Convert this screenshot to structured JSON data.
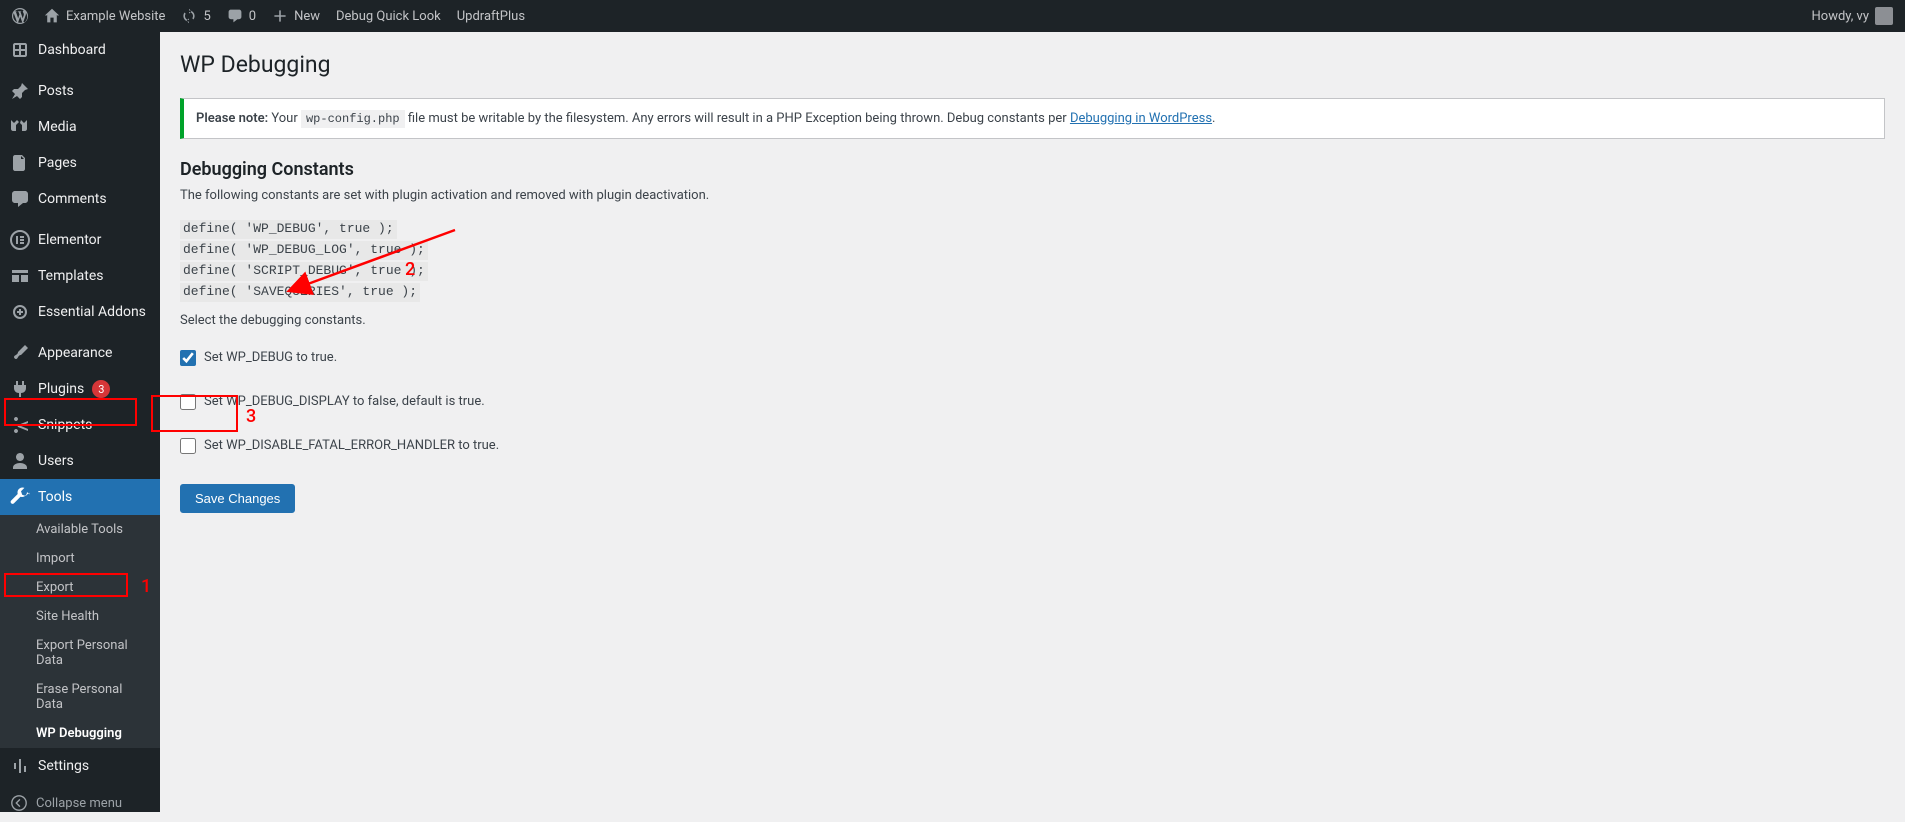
{
  "adminbar": {
    "site": "Example Website",
    "refresh_count": "5",
    "comments_count": "0",
    "new_label": "New",
    "debug_link": "Debug Quick Look",
    "updraft_link": "UpdraftPlus",
    "greeting": "Howdy, vy"
  },
  "sidebar": {
    "dashboard": "Dashboard",
    "posts": "Posts",
    "media": "Media",
    "pages": "Pages",
    "comments": "Comments",
    "elementor": "Elementor",
    "templates": "Templates",
    "essential_addons": "Essential Addons",
    "appearance": "Appearance",
    "plugins": "Plugins",
    "plugins_badge": "3",
    "snippets": "Snippets",
    "users": "Users",
    "tools": "Tools",
    "tools_sub": {
      "available": "Available Tools",
      "import": "Import",
      "export": "Export",
      "site_health": "Site Health",
      "export_personal": "Export Personal Data",
      "erase_personal": "Erase Personal Data",
      "wp_debugging": "WP Debugging"
    },
    "settings": "Settings",
    "collapse": "Collapse menu"
  },
  "main": {
    "title": "WP Debugging",
    "notice_bold": "Please note:",
    "notice_your": " Your ",
    "notice_code": "wp-config.php",
    "notice_mid": " file must be writable by the filesystem. Any errors will result in a PHP Exception being thrown. Debug constants per ",
    "notice_link": "Debugging in WordPress",
    "notice_end": ".",
    "h2": "Debugging Constants",
    "p1": "The following constants are set with plugin activation and removed with plugin deactivation.",
    "code_l1": "define( 'WP_DEBUG', true );",
    "code_l2": "define( 'WP_DEBUG_LOG', true );",
    "code_l3": "define( 'SCRIPT_DEBUG', true );",
    "code_l4": "define( 'SAVEQUERIES', true );",
    "p2": "Select the debugging constants.",
    "opt1": "Set WP_DEBUG to true.",
    "opt2": "Set WP_DEBUG_DISPLAY to false, default is true.",
    "opt3": "Set WP_DISABLE_FATAL_ERROR_HANDLER to true.",
    "save": "Save Changes"
  },
  "annotation": {
    "n1": "1",
    "n2": "2",
    "n3": "3"
  }
}
